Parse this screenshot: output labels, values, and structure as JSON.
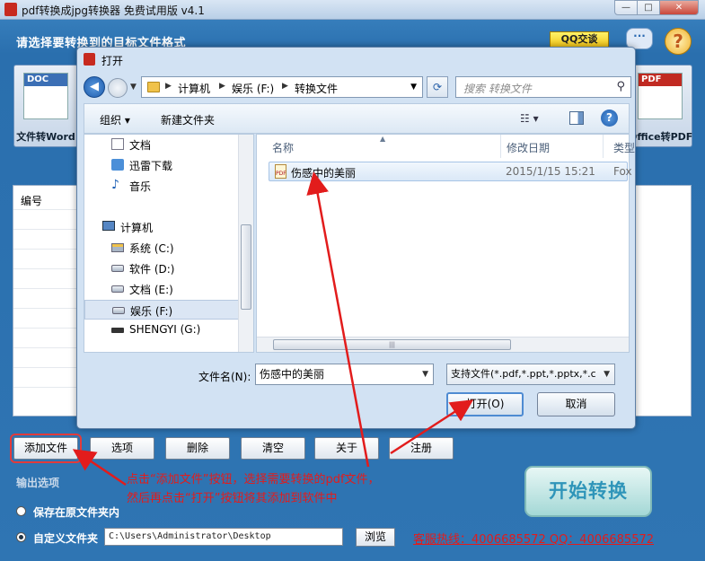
{
  "app": {
    "title": "pdf转换成jpg转换器 免费试用版 v4.1",
    "window_controls": {
      "minimize": "—",
      "maximize": "□",
      "close": "✕"
    },
    "header_prompt": "请选择要转换到的目标文件格式",
    "qq_badge": "QQ交谈",
    "chat_icon": "···",
    "help_icon": "?"
  },
  "formats": {
    "left": {
      "tag": "DOC",
      "label": "文件转Word"
    },
    "right": {
      "tag": "PDF",
      "label": "Office转PDF"
    }
  },
  "file_table": {
    "col_no": "编号"
  },
  "toolbar": {
    "add": "添加文件",
    "options": "选项",
    "delete": "删除",
    "clear": "清空",
    "about": "关于",
    "register": "注册"
  },
  "output": {
    "title": "输出选项",
    "keep_original": "保存在原文件夹内",
    "custom_folder": "自定义文件夹",
    "path": "C:\\Users\\Administrator\\Desktop",
    "browse": "浏览",
    "hotline": "客服热线：4006685572 QQ：4006685572"
  },
  "start_button": "开始转换",
  "dialog": {
    "title": "打开",
    "breadcrumb": [
      "计算机",
      "娱乐 (F:)",
      "转换文件"
    ],
    "search_placeholder": "搜索 转换文件",
    "organize": "组织 ▾",
    "new_folder": "新建文件夹",
    "nav_items": [
      {
        "label": "文档",
        "icon": "document-icon"
      },
      {
        "label": "迅雷下载",
        "icon": "thunder-icon"
      },
      {
        "label": "音乐",
        "icon": "music-icon"
      },
      {
        "label": "计算机",
        "icon": "computer-icon"
      },
      {
        "label": "系统 (C:)",
        "icon": "system-drive-icon"
      },
      {
        "label": "软件 (D:)",
        "icon": "drive-icon"
      },
      {
        "label": "文档 (E:)",
        "icon": "drive-icon"
      },
      {
        "label": "娱乐 (F:)",
        "icon": "drive-icon"
      },
      {
        "label": "SHENGYI (G:)",
        "icon": "usb-drive-icon"
      }
    ],
    "columns": {
      "name": "名称",
      "date": "修改日期",
      "type": "类型"
    },
    "file": {
      "name": "伤感中的美丽",
      "date": "2015/1/15 15:21",
      "type": "Fox"
    },
    "filename_label": "文件名(N):",
    "filename_value": "伤感中的美丽",
    "filetype_value": "支持文件(*.pdf,*.ppt,*.pptx,*.c",
    "open": "打开(O)",
    "cancel": "取消"
  },
  "annotation": {
    "line1": "点击“添加文件”按钮，选择需要转换的pdf文件，",
    "line2": "然后再点击“打开”按钮将其添加到软件中"
  },
  "colors": {
    "annotation": "#e21c1c",
    "accent_blue": "#2f75b3"
  }
}
